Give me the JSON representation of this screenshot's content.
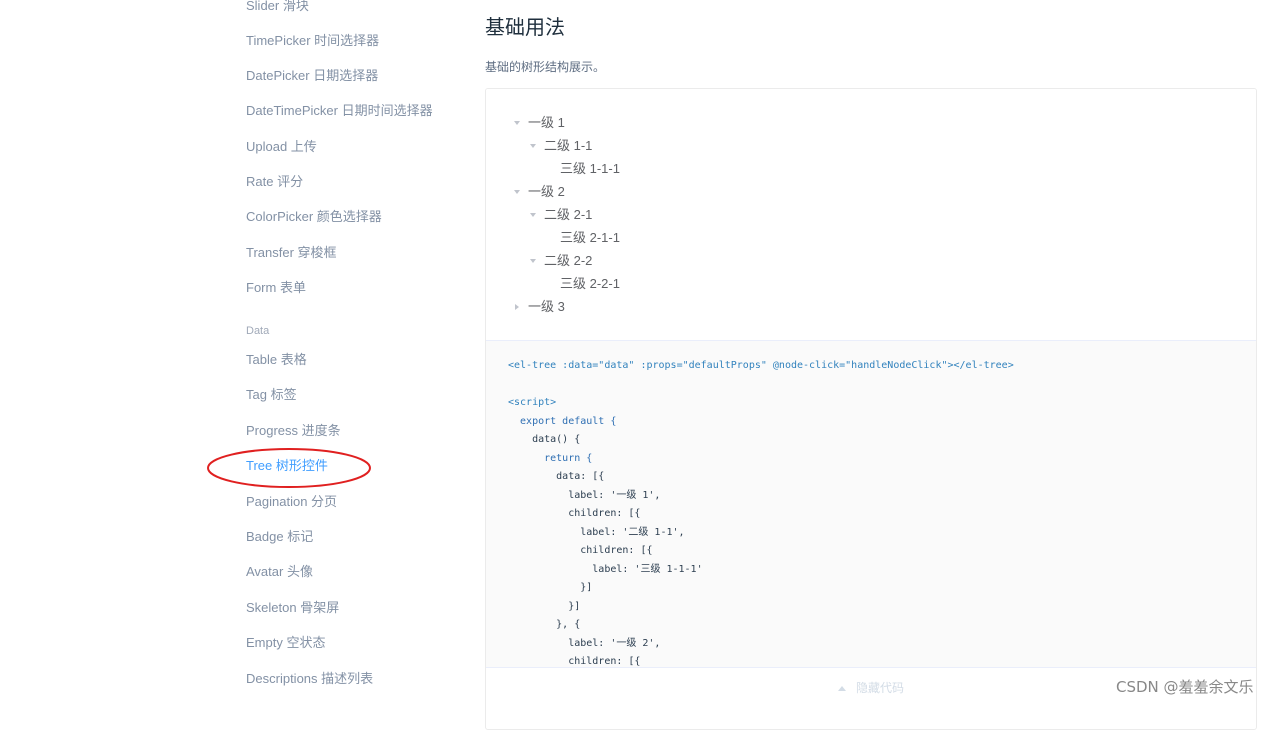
{
  "sidebar": {
    "items": [
      {
        "label": "Slider 滑块"
      },
      {
        "label": "TimePicker 时间选择器"
      },
      {
        "label": "DatePicker 日期选择器"
      },
      {
        "label": "DateTimePicker 日期时间选择器"
      },
      {
        "label": "Upload 上传"
      },
      {
        "label": "Rate 评分"
      },
      {
        "label": "ColorPicker 颜色选择器"
      },
      {
        "label": "Transfer 穿梭框"
      },
      {
        "label": "Form 表单"
      }
    ],
    "group_data": "Data",
    "data_items": [
      {
        "label": "Table 表格"
      },
      {
        "label": "Tag 标签"
      },
      {
        "label": "Progress 进度条"
      },
      {
        "label": "Tree 树形控件"
      },
      {
        "label": "Pagination 分页"
      },
      {
        "label": "Badge 标记"
      },
      {
        "label": "Avatar 头像"
      },
      {
        "label": "Skeleton 骨架屏"
      },
      {
        "label": "Empty 空状态"
      },
      {
        "label": "Descriptions 描述列表"
      }
    ],
    "active_item": "Tree 树形控件",
    "annotation_color": "#e02020"
  },
  "main": {
    "title": "基础用法",
    "description": "基础的树形结构展示。",
    "tree": [
      {
        "label": "一级 1",
        "level": 1,
        "state": "expanded"
      },
      {
        "label": "二级 1-1",
        "level": 2,
        "state": "expanded"
      },
      {
        "label": "三级 1-1-1",
        "level": 3,
        "state": "leaf"
      },
      {
        "label": "一级 2",
        "level": 1,
        "state": "expanded"
      },
      {
        "label": "二级 2-1",
        "level": 2,
        "state": "expanded"
      },
      {
        "label": "三级 2-1-1",
        "level": 3,
        "state": "leaf"
      },
      {
        "label": "二级 2-2",
        "level": 2,
        "state": "expanded"
      },
      {
        "label": "三级 2-2-1",
        "level": 3,
        "state": "leaf"
      },
      {
        "label": "一级 3",
        "level": 1,
        "state": "collapsed"
      }
    ],
    "code": {
      "line1": "<el-tree :data=\"data\" :props=\"defaultProps\" @node-click=\"handleNodeClick\"></el-tree>",
      "line2": "<script>",
      "line3": "  export default {",
      "line4": "    data() {",
      "line5": "      return {",
      "line6": "        data: [{",
      "line7": "          label: '一级 1',",
      "line8": "          children: [{",
      "line9": "            label: '二级 1-1',",
      "line10": "            children: [{",
      "line11": "              label: '三级 1-1-1'",
      "line12": "            }]",
      "line13": "          }]",
      "line14": "        }, {",
      "line15": "          label: '一级 2',",
      "line16": "          children: [{"
    },
    "control_label": "隐藏代码"
  },
  "watermark": "CSDN @羞羞余文乐",
  "colors": {
    "accent": "#409eff",
    "title": "#1f2f3d",
    "nav_text": "#8391a5"
  }
}
